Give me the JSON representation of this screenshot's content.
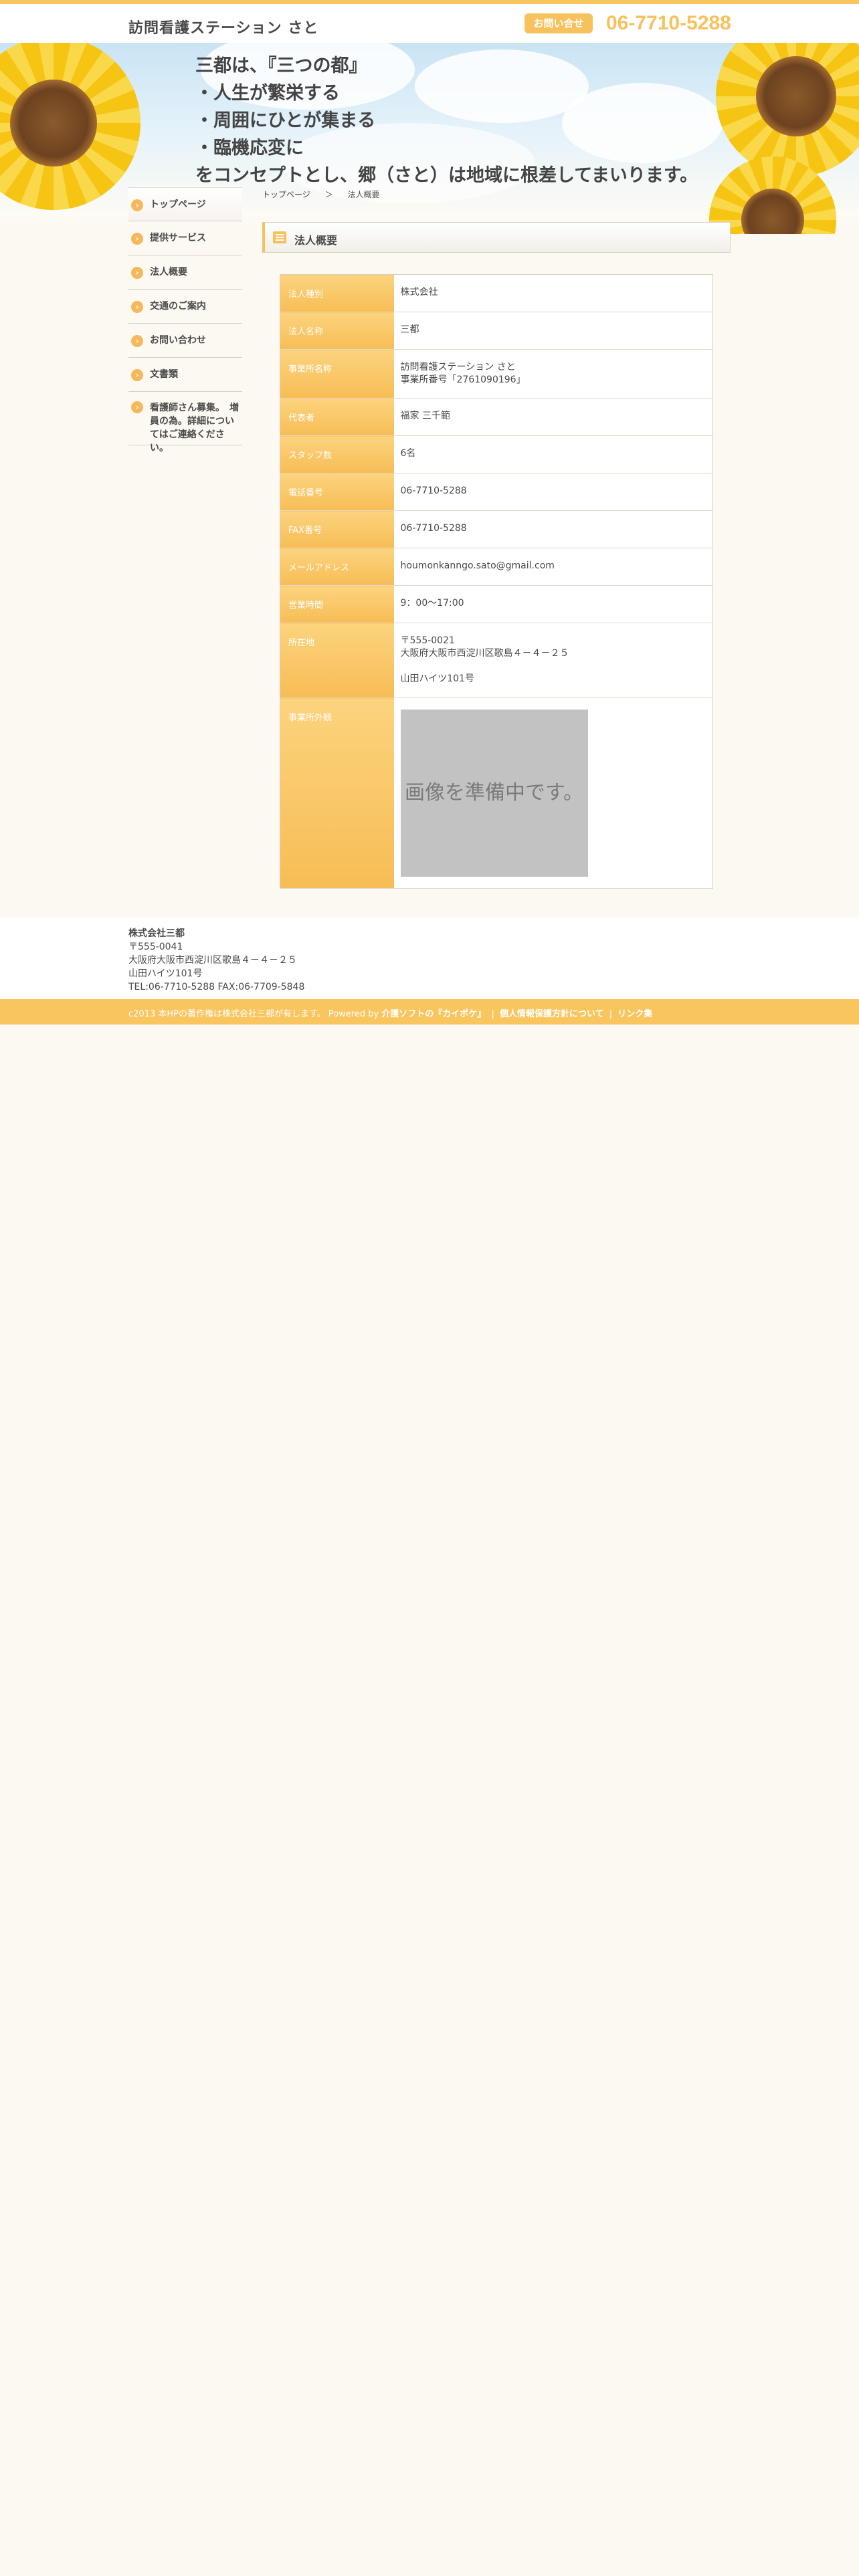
{
  "header": {
    "site_title": "訪問看護ステーション さと",
    "contact_label": "お問い合せ",
    "phone": "06-7710-5288"
  },
  "hero": {
    "lines": [
      "三都は、『三つの都』",
      "・人生が繁栄する",
      "・周囲にひとが集まる",
      "・臨機応変に",
      "をコンセプトとし、郷（さと）は地域に根差してまいります。"
    ]
  },
  "breadcrumb": {
    "home": "トップページ",
    "separator": "＞",
    "current": "法人概要"
  },
  "sidebar": {
    "items": [
      {
        "label": "トップページ"
      },
      {
        "label": "提供サービス"
      },
      {
        "label": "法人概要"
      },
      {
        "label": "交通のご案内"
      },
      {
        "label": "お問い合わせ"
      },
      {
        "label": "文書類"
      },
      {
        "label": "看護師さん募集。　増員の為。詳細についてはご連絡ください。"
      }
    ]
  },
  "page": {
    "heading": "法人概要"
  },
  "table": {
    "rows": [
      {
        "label": "法人種別",
        "value": "株式会社"
      },
      {
        "label": "法人名称",
        "value": "三都"
      },
      {
        "label": "事業所名称",
        "value": "訪問看護ステーション さと",
        "value2": "事業所番号「2761090196」"
      },
      {
        "label": "代表者",
        "value": "福家 三千範"
      },
      {
        "label": "スタッフ数",
        "value": "6名"
      },
      {
        "label": "電話番号",
        "value": "06-7710-5288"
      },
      {
        "label": "FAX番号",
        "value": "06-7710-5288"
      },
      {
        "label": "メールアドレス",
        "value": "houmonkanngo.sato@gmail.com"
      },
      {
        "label": "営業時間",
        "value": "9：00〜17:00"
      },
      {
        "label": "所在地",
        "value": "〒555-0021",
        "value2": "大阪府大阪市西淀川区歌島４－４－２５",
        "value3": "山田ハイツ101号"
      },
      {
        "label": "事業所外観",
        "image_text": "画像を準備中です。"
      }
    ]
  },
  "footer": {
    "company": "株式会社三都",
    "postal": "〒555-0041",
    "address": "大阪府大阪市西淀川区歌島４－４－２５",
    "building": "山田ハイツ101号",
    "tel_fax": "TEL:06-7710-5288 FAX:06-7709-5848",
    "copyright": "c2013 本HPの著作権は株式会社三都が有します。 Powered by ",
    "link1": "介護ソフトの『カイポケ』",
    "link_sep": "|",
    "link2": "個人情報保護方針について",
    "link3": "リンク集"
  }
}
